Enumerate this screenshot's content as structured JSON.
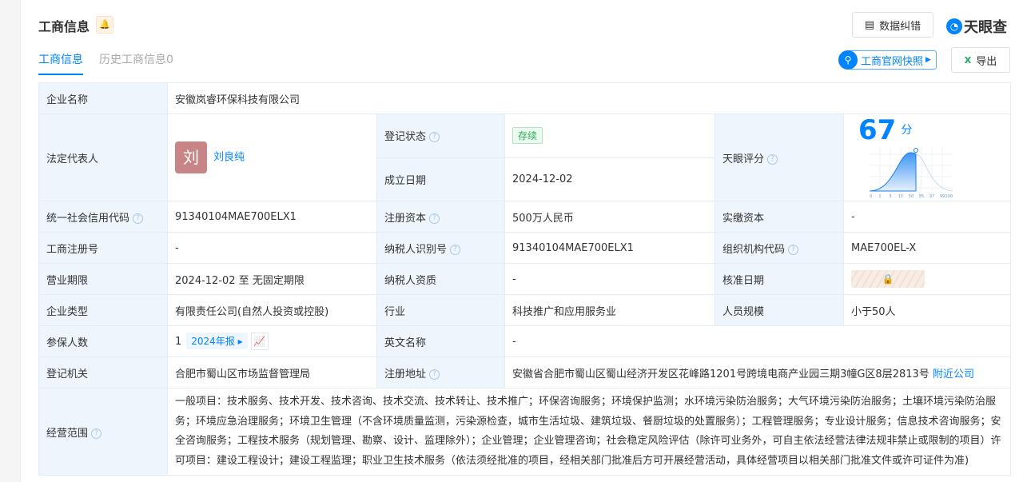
{
  "header": {
    "title": "工商信息",
    "correct_label": "数据纠错",
    "brand": "天眼查",
    "snapshot_label": "工商官网快照",
    "export_label": "导出"
  },
  "tabs": [
    {
      "label": "工商信息"
    },
    {
      "label": "历史工商信息0"
    }
  ],
  "score": {
    "value": "67",
    "unit": "分",
    "axis": [
      "0",
      "1",
      "3",
      "15",
      "50",
      "85",
      "97",
      "99",
      "100"
    ]
  },
  "rows": {
    "company_name": {
      "label": "企业名称",
      "value": "安徽岚睿环保科技有限公司"
    },
    "legal_rep": {
      "label": "法定代表人",
      "avatar": "刘",
      "value": "刘良纯"
    },
    "status": {
      "label": "登记状态",
      "value": "存续"
    },
    "found_date": {
      "label": "成立日期",
      "value": "2024-12-02"
    },
    "rating": {
      "label": "天眼评分"
    },
    "credit_code": {
      "label": "统一社会信用代码",
      "value": "91340104MAE700ELX1"
    },
    "reg_capital": {
      "label": "注册资本",
      "value": "500万人民币"
    },
    "paid_capital": {
      "label": "实缴资本",
      "value": "-"
    },
    "reg_no": {
      "label": "工商注册号",
      "value": "-"
    },
    "taxpayer_id": {
      "label": "纳税人识别号",
      "value": "91340104MAE700ELX1"
    },
    "org_code": {
      "label": "组织机构代码",
      "value": "MAE700EL-X"
    },
    "term": {
      "label": "营业期限",
      "value": "2024-12-02 至 无固定期限"
    },
    "taxpayer_qual": {
      "label": "纳税人资质",
      "value": "-"
    },
    "approve_date": {
      "label": "核准日期"
    },
    "type": {
      "label": "企业类型",
      "value": "有限责任公司(自然人投资或控股)"
    },
    "industry": {
      "label": "行业",
      "value": "科技推广和应用服务业"
    },
    "staff": {
      "label": "人员规模",
      "value": "小于50人"
    },
    "insured": {
      "label": "参保人数",
      "value": "1",
      "report": "2024年报"
    },
    "en_name": {
      "label": "英文名称",
      "value": "-"
    },
    "authority": {
      "label": "登记机关",
      "value": "合肥市蜀山区市场监督管理局"
    },
    "address": {
      "label": "注册地址",
      "value": "安徽省合肥市蜀山区蜀山经济开发区花峰路1201号跨境电商产业园三期3幢G区8层2813号",
      "nearby": "附近公司"
    },
    "scope": {
      "label": "经营范围",
      "value": "一般项目：技术服务、技术开发、技术咨询、技术交流、技术转让、技术推广；环保咨询服务；环境保护监测；水环境污染防治服务；大气环境污染防治服务；土壤环境污染防治服务；环境应急治理服务；环境卫生管理（不含环境质量监测，污染源检查，城市生活垃圾、建筑垃圾、餐厨垃圾的处置服务）；工程管理服务；专业设计服务；信息技术咨询服务；安全咨询服务；工程技术服务（规划管理、勘察、设计、监理除外）；企业管理；企业管理咨询；社会稳定风险评估（除许可业务外，可自主依法经营法律法规非禁止或限制的项目）许可项目：建设工程设计；建设工程监理；职业卫生技术服务（依法须经批准的项目，经相关部门批准后方可开展经营活动，具体经营项目以相关部门批准文件或许可证件为准)"
    }
  }
}
